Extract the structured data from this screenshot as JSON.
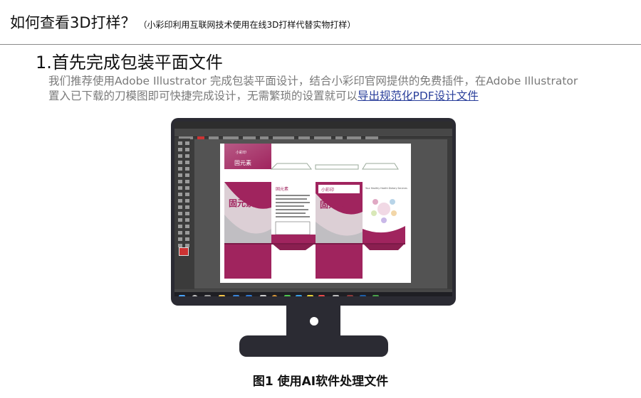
{
  "header": {
    "title": "如何查看3D打样？",
    "subtitle": "（小彩印利用互联网技术使用在线3D打样代替实物打样）"
  },
  "section": {
    "title": "1.首先完成包装平面文件",
    "paragraph_text": "我们推荐使用Adobe Illustrator 完成包装平面设计，结合小彩印官网提供的免费插件，在Adobe Illustrator 置入已下载的刀模图即可快捷完成设计，无需繁琐的设置就可以",
    "paragraph_link": "导出规范化PDF设计文件"
  },
  "artwork": {
    "brand_left": "小彩印",
    "brand_right": "小彩印",
    "product_name": "固元素",
    "product_name_small": "固元素",
    "back_heading": "Your Healthy Health Dietary Services",
    "colors": {
      "magenta": "#a0245e",
      "magenta_dark": "#7c1a48",
      "silver": "#d6d6d6"
    }
  },
  "caption": "图1 使用AI软件处理文件"
}
